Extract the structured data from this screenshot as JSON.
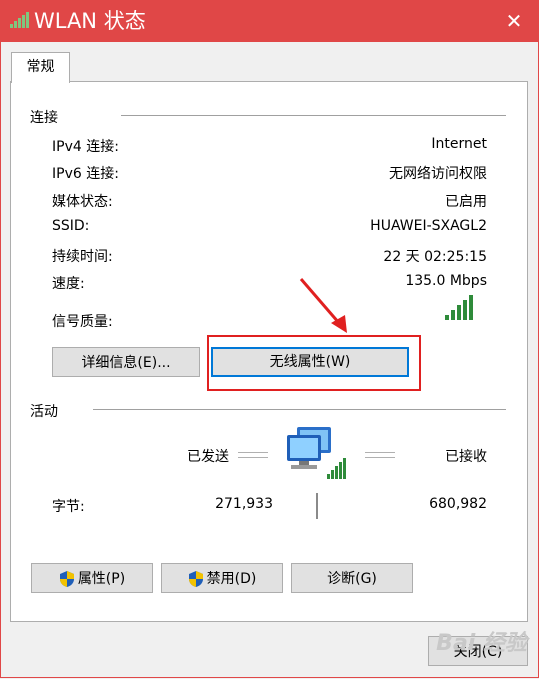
{
  "window": {
    "title": "WLAN 状态",
    "close_glyph": "✕",
    "accent_color": "#e04747"
  },
  "tabs": [
    {
      "label": "常规"
    }
  ],
  "connection": {
    "section_title": "连接",
    "rows": [
      {
        "label": "IPv4 连接:",
        "value": "Internet"
      },
      {
        "label": "IPv6 连接:",
        "value": "无网络访问权限"
      },
      {
        "label": "媒体状态:",
        "value": "已启用"
      },
      {
        "label": "SSID:",
        "value": "HUAWEI-SXAGL2"
      },
      {
        "label": "持续时间:",
        "value": "22 天 02:25:15"
      },
      {
        "label": "速度:",
        "value": "135.0 Mbps"
      }
    ],
    "signal_label": "信号质量:",
    "signal_bars_total": 5,
    "signal_bars_active": 5,
    "signal_icon": "signal-bars-icon"
  },
  "buttons_top": {
    "details": "详细信息(E)...",
    "wireless_properties": "无线属性(W)"
  },
  "activity": {
    "section_title": "活动",
    "sent_label": "已发送",
    "received_label": "已接收",
    "bytes_label": "字节:",
    "bytes_sent": "271,933",
    "bytes_received": "680,982",
    "network_icon": "network-computer-icon"
  },
  "buttons_bottom": {
    "properties": "属性(P)",
    "disable": "禁用(D)",
    "diagnose": "诊断(G)",
    "shield_icon": "uac-shield-icon"
  },
  "footer": {
    "close": "关闭(C)"
  },
  "watermark": "Bai 经验"
}
